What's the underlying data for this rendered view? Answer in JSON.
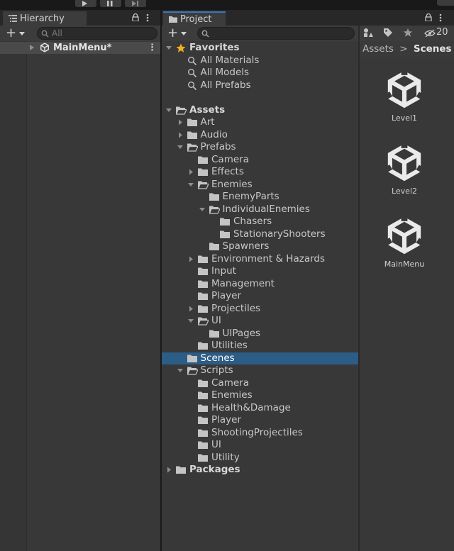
{
  "hierarchy": {
    "tab_title": "Hierarchy",
    "search_placeholder": "All",
    "scene_name": "MainMenu*"
  },
  "project": {
    "tab_title": "Project",
    "hidden_count": "20",
    "breadcrumb": {
      "root": "Assets",
      "separator": ">",
      "current": "Scenes"
    },
    "tree": [
      {
        "label": "Favorites",
        "depth": 0,
        "icon": "star-icon",
        "expand": "open",
        "bold": true
      },
      {
        "label": "All Materials",
        "depth": 1,
        "icon": "search-icon",
        "expand": "none"
      },
      {
        "label": "All Models",
        "depth": 1,
        "icon": "search-icon",
        "expand": "none"
      },
      {
        "label": "All Prefabs",
        "depth": 1,
        "icon": "search-icon",
        "expand": "none"
      },
      {
        "label": "",
        "depth": 0,
        "icon": "",
        "expand": "spacer"
      },
      {
        "label": "Assets",
        "depth": 0,
        "icon": "folder-open-icon",
        "expand": "open",
        "bold": true
      },
      {
        "label": "Art",
        "depth": 1,
        "icon": "folder-icon",
        "expand": "closed"
      },
      {
        "label": "Audio",
        "depth": 1,
        "icon": "folder-icon",
        "expand": "closed"
      },
      {
        "label": "Prefabs",
        "depth": 1,
        "icon": "folder-open-icon",
        "expand": "open"
      },
      {
        "label": "Camera",
        "depth": 2,
        "icon": "folder-icon",
        "expand": "none"
      },
      {
        "label": "Effects",
        "depth": 2,
        "icon": "folder-icon",
        "expand": "closed"
      },
      {
        "label": "Enemies",
        "depth": 2,
        "icon": "folder-open-icon",
        "expand": "open"
      },
      {
        "label": "EnemyParts",
        "depth": 3,
        "icon": "folder-icon",
        "expand": "none"
      },
      {
        "label": "IndividualEnemies",
        "depth": 3,
        "icon": "folder-open-icon",
        "expand": "open"
      },
      {
        "label": "Chasers",
        "depth": 4,
        "icon": "folder-icon",
        "expand": "none"
      },
      {
        "label": "StationaryShooters",
        "depth": 4,
        "icon": "folder-icon",
        "expand": "none"
      },
      {
        "label": "Spawners",
        "depth": 3,
        "icon": "folder-icon",
        "expand": "none"
      },
      {
        "label": "Environment & Hazards",
        "depth": 2,
        "icon": "folder-icon",
        "expand": "closed"
      },
      {
        "label": "Input",
        "depth": 2,
        "icon": "folder-icon",
        "expand": "none"
      },
      {
        "label": "Management",
        "depth": 2,
        "icon": "folder-icon",
        "expand": "none"
      },
      {
        "label": "Player",
        "depth": 2,
        "icon": "folder-icon",
        "expand": "none"
      },
      {
        "label": "Projectiles",
        "depth": 2,
        "icon": "folder-icon",
        "expand": "closed"
      },
      {
        "label": "UI",
        "depth": 2,
        "icon": "folder-open-icon",
        "expand": "open"
      },
      {
        "label": "UIPages",
        "depth": 3,
        "icon": "folder-icon",
        "expand": "none"
      },
      {
        "label": "Utilities",
        "depth": 2,
        "icon": "folder-icon",
        "expand": "none"
      },
      {
        "label": "Scenes",
        "depth": 1,
        "icon": "folder-icon",
        "expand": "none",
        "selected": true
      },
      {
        "label": "Scripts",
        "depth": 1,
        "icon": "folder-open-icon",
        "expand": "open"
      },
      {
        "label": "Camera",
        "depth": 2,
        "icon": "folder-icon",
        "expand": "none"
      },
      {
        "label": "Enemies",
        "depth": 2,
        "icon": "folder-icon",
        "expand": "none"
      },
      {
        "label": "Health&Damage",
        "depth": 2,
        "icon": "folder-icon",
        "expand": "none"
      },
      {
        "label": "Player",
        "depth": 2,
        "icon": "folder-icon",
        "expand": "none"
      },
      {
        "label": "ShootingProjectiles",
        "depth": 2,
        "icon": "folder-icon",
        "expand": "none"
      },
      {
        "label": "UI",
        "depth": 2,
        "icon": "folder-icon",
        "expand": "none"
      },
      {
        "label": "Utility",
        "depth": 2,
        "icon": "folder-icon",
        "expand": "none"
      },
      {
        "label": "Packages",
        "depth": 0,
        "icon": "folder-icon",
        "expand": "closed",
        "bold": true
      }
    ],
    "assets": [
      {
        "label": "Level1",
        "icon": "unity-scene-icon"
      },
      {
        "label": "Level2",
        "icon": "unity-scene-icon"
      },
      {
        "label": "MainMenu",
        "icon": "unity-scene-icon"
      }
    ]
  },
  "colors": {
    "panel": "#383838",
    "selection": "#2c5d87",
    "accent": "#3a79bb",
    "favorite_star": "#f2b01e"
  }
}
